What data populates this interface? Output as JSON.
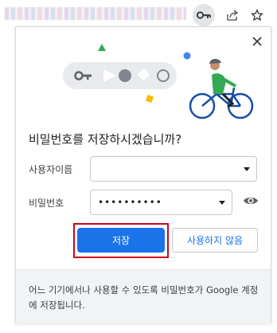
{
  "addressbar": {
    "icons": [
      "key-icon",
      "share-icon",
      "star-icon"
    ]
  },
  "dialog": {
    "title": "비밀번호를 저장하시겠습니까?",
    "username_label": "사용자이름",
    "username_value": "",
    "password_label": "비밀번호",
    "password_value": "••••••••••",
    "save_label": "저장",
    "never_label": "사용하지 않음",
    "footer_text": "어느 기기에서나 사용할 수 있도록 비밀번호가 Google 계정에 저장됩니다."
  },
  "colors": {
    "accent": "#1a73e8",
    "highlight_border": "#d0021b",
    "footer_bg": "#f1f3f4"
  }
}
